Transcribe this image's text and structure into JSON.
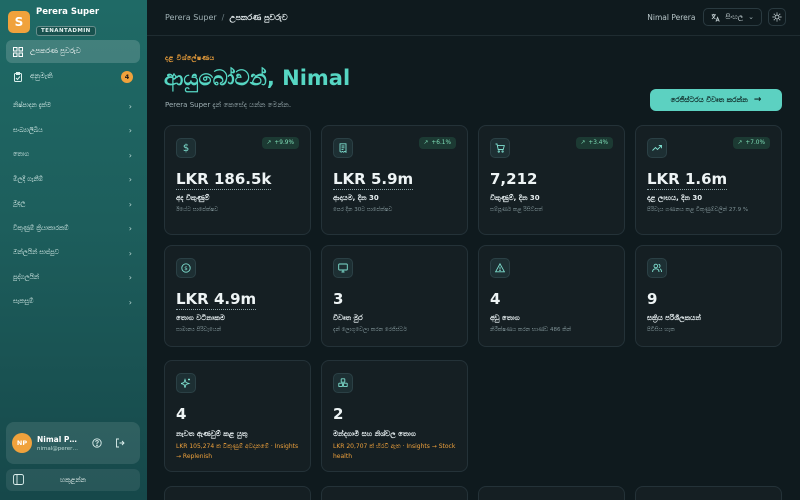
{
  "brand": {
    "logo_letter": "S",
    "name": "Perera Super",
    "badge": "TENANTADMIN"
  },
  "sidebar": {
    "items": [
      {
        "label": "උපකරණ පුවරුව",
        "icon": "dashboard-icon",
        "active": true
      },
      {
        "label": "අනුමැති",
        "icon": "clipboard-check-icon",
        "badge": "4"
      }
    ],
    "groups": [
      "නිෂ්පාදන දැක්ම",
      "සංඛ්‍යාලිඛිය",
      "තොග",
      "මිලදී ගැනීම්",
      "මුදල",
      "විකුණුම් ක්‍රියාකාරකම්",
      "ඔන්ලයින් සාප්පුව",
      "පුද්ගලයින්",
      "සැකසුම්"
    ],
    "user": {
      "initials": "NP",
      "name": "Nimal Perera",
      "email": "nimal@perera.lk"
    },
    "collapse_label": "හකුළන්න"
  },
  "topbar": {
    "breadcrumb_root": "Perera Super",
    "breadcrumb_sep": "/",
    "breadcrumb_current": "උපකරණ පුවරුව",
    "user_name": "Nimal Perera",
    "language": "සිංහල"
  },
  "header": {
    "eyebrow": "දළ විශ්ලේෂණය",
    "title": "ආයුබෝවන්, Nimal",
    "subtitle": "Perera Super දැන් කෙසේද යන්න මෙන්න.",
    "report_button": "රෙජිස්ටරය විවෘත කරන්න"
  },
  "colors": {
    "accent": "#5cd1c1",
    "brand": "#f0a23c",
    "positive": "#7fe0b8",
    "warning": "#f0a23c"
  },
  "cards": [
    {
      "icon": "dollar-icon",
      "delta": "+9.9%",
      "value": "LKR 186.5k",
      "label": "අද විකුණුම්",
      "desc": "ඊයේට සාපේක්ෂව"
    },
    {
      "icon": "receipt-icon",
      "delta": "+6.1%",
      "value": "LKR 5.9m",
      "label": "ආදායම, දින 30",
      "desc": "පෙර දින 30ට සාපේක්ෂව"
    },
    {
      "icon": "cart-icon",
      "delta": "+3.4%",
      "value": "7,212",
      "label": "විකුණුම්, දින 30",
      "desc": "සම්පූර්ණ කළ රිසිට්පත්"
    },
    {
      "icon": "trend-up-icon",
      "delta": "+7.0%",
      "value": "LKR 1.6m",
      "label": "දළ ලාභය, දින 30",
      "desc": "පිරිවැය ගණනය කළ විකුණුම්වලින් 27.9 %"
    },
    {
      "icon": "coin-icon",
      "value": "LKR 4.9m",
      "label": "තොග වටිනාකම",
      "desc": "සාමාන්‍ය පිරිවැයෙන්"
    },
    {
      "icon": "monitor-icon",
      "value": "3",
      "label": "විවෘත මුර",
      "desc": "දැන් ලොගුවෙලා කරන රෙජිස්ටර්"
    },
    {
      "icon": "alert-icon",
      "value": "4",
      "label": "අඩු තොග",
      "desc": "නිරීක්ෂණය කරන භාණ්ඩ 486 කින්"
    },
    {
      "icon": "users-icon",
      "value": "9",
      "label": "සක්‍රිය පරිශීලකයන්",
      "desc": "පිවිසිය හැක"
    },
    {
      "icon": "sparkle-icon",
      "value": "4",
      "label": "නැවත ඇණවුම් කළ යුතු",
      "warn": "LKR 105,274 ක විකුණුම් අවදානමේ · Insights → Replenish"
    },
    {
      "icon": "boxes-icon",
      "value": "2",
      "label": "මන්දගාමී සහ නිශ්චල තොග",
      "warn": "LKR 20,707 ක් හිරවී ඇත · Insights → Stock health"
    }
  ]
}
